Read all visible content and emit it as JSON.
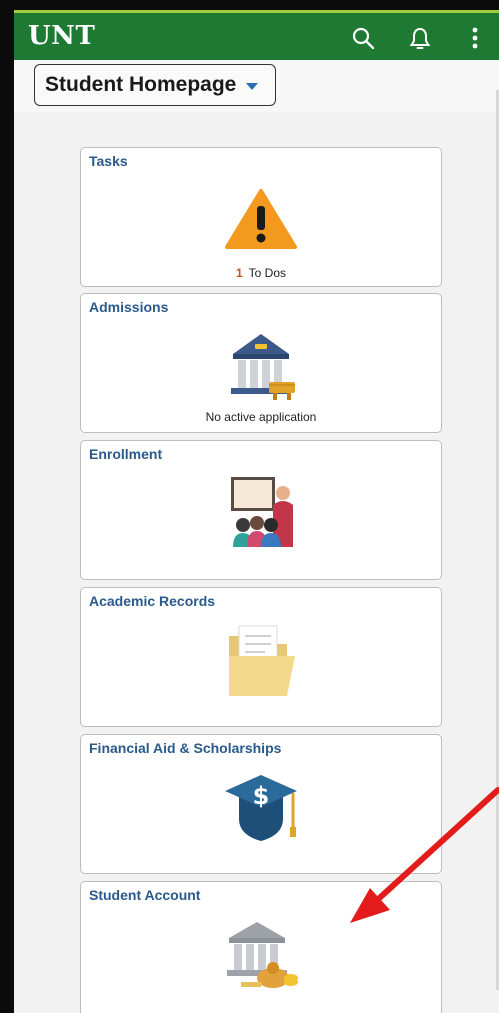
{
  "header": {
    "logo": "UNT"
  },
  "homepage_selector": {
    "label": "Student Homepage"
  },
  "tiles": [
    {
      "title": "Tasks",
      "count": "1",
      "footer": "To Dos"
    },
    {
      "title": "Admissions",
      "footer": "No active application"
    },
    {
      "title": "Enrollment"
    },
    {
      "title": "Academic Records"
    },
    {
      "title": "Financial Aid & Scholarships"
    },
    {
      "title": "Student Account"
    }
  ],
  "colors": {
    "header_green": "#1e7a33",
    "header_accent": "#9ccb3b",
    "title_blue": "#2a5a8c",
    "arrow_red": "#e31b1b"
  }
}
